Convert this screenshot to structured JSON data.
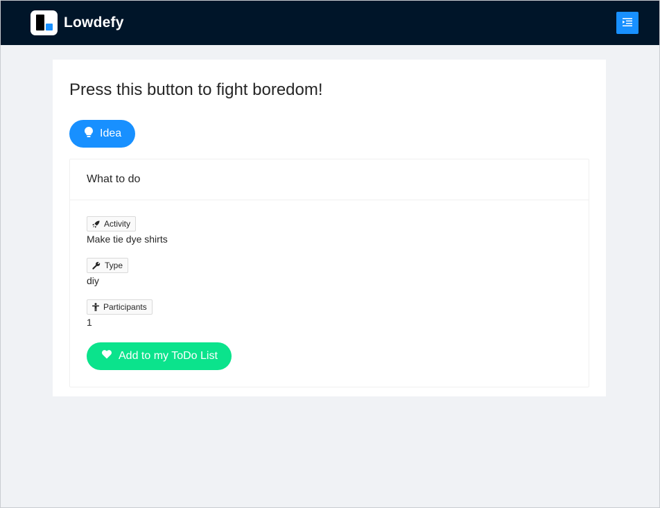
{
  "header": {
    "brand_name": "Lowdefy",
    "menu_icon": "menu-fold-icon",
    "colors": {
      "background": "#001529",
      "accent": "#1890ff"
    }
  },
  "page": {
    "title": "Press this button to fight boredom!",
    "idea_button": {
      "label": "Idea",
      "icon": "bulb-icon",
      "color": "#1890ff"
    }
  },
  "card": {
    "title": "What to do",
    "fields": [
      {
        "label": "Activity",
        "icon": "rocket-icon",
        "value": "Make tie dye shirts"
      },
      {
        "label": "Type",
        "icon": "wrench-icon",
        "value": "diy"
      },
      {
        "label": "Participants",
        "icon": "person-icon",
        "value": "1"
      }
    ],
    "todo_button": {
      "label": "Add to my ToDo List",
      "icon": "heart-icon",
      "color": "#0be38c"
    }
  }
}
